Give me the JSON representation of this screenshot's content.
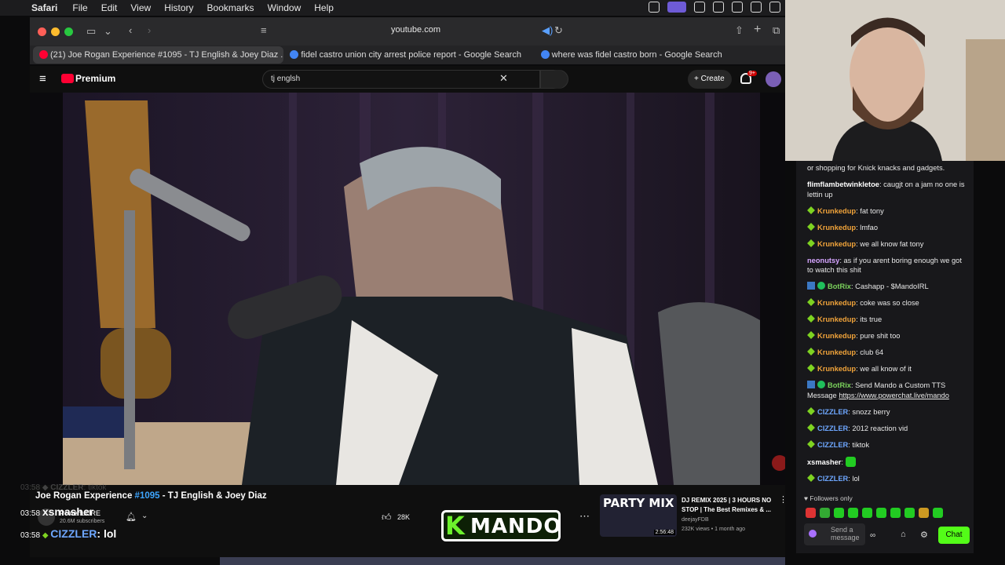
{
  "menubar": {
    "app": "Safari",
    "items": [
      "File",
      "Edit",
      "View",
      "History",
      "Bookmarks",
      "Window",
      "Help"
    ]
  },
  "browser": {
    "url": "youtube.com",
    "tabs": [
      {
        "title": "(21) Joe Rogan Experience #1095 - TJ English & Joey Diaz ..."
      },
      {
        "title": "fidel castro union city arrest police report - Google Search"
      },
      {
        "title": "where was fidel castro born - Google Search"
      }
    ]
  },
  "youtube": {
    "logo": "Premium",
    "search_value": "tj englsh",
    "create_label": "Create",
    "notif_count": "9+",
    "video": {
      "title_prefix": "Joe Rogan Experience ",
      "title_link": "#1095",
      "title_suffix": " - TJ English & Joey Diaz",
      "channel": "PowerfulJRE",
      "subscribers": "20.6M subscribers",
      "likes": "28K"
    },
    "recommended": {
      "thumb_text": "PARTY MIX",
      "title": "DJ REMIX 2025 | 3 HOURS NO STOP | The Best Remixes & ...",
      "channel": "deejayFDB",
      "meta": "232K views • 1 month ago",
      "duration": "2:56:48"
    }
  },
  "overlay": {
    "mando": "MANDO",
    "lines": [
      {
        "time": "03:58",
        "user": "CIZZLER",
        "text": "tiktok"
      },
      {
        "time": "03:58",
        "user": "xsmasher",
        "text": ""
      },
      {
        "time": "03:58",
        "user": "CIZZLER",
        "text": "lol"
      }
    ]
  },
  "chat": {
    "messages": [
      {
        "user": "",
        "text": "or shopping for Knick knacks and gadgets.",
        "color": "#e8e8e8"
      },
      {
        "user": "flimflambetwinkletoe",
        "text": "caugjt on a jam no one is lettin up",
        "color": "#ffffff"
      },
      {
        "user": "Krunkedup",
        "text": "fat tony",
        "color": "#f0a33a"
      },
      {
        "user": "Krunkedup",
        "text": "lmfao",
        "color": "#f0a33a"
      },
      {
        "user": "Krunkedup",
        "text": "we all know fat tony",
        "color": "#f0a33a"
      },
      {
        "user": "neonutsy",
        "text": "as if you arent boring enough we got to watch this shit",
        "color": "#d5a5ff"
      },
      {
        "user": "BotRix",
        "text": "Cashapp - $MandoIRL",
        "color": "#7bd35c"
      },
      {
        "user": "Krunkedup",
        "text": "coke was so close",
        "color": "#f0a33a"
      },
      {
        "user": "Krunkedup",
        "text": "its true",
        "color": "#f0a33a"
      },
      {
        "user": "Krunkedup",
        "text": "pure shit too",
        "color": "#f0a33a"
      },
      {
        "user": "Krunkedup",
        "text": "club 64",
        "color": "#f0a33a"
      },
      {
        "user": "Krunkedup",
        "text": "we all know of it",
        "color": "#f0a33a"
      },
      {
        "user": "BotRix",
        "text": "Send Mando a Custom TTS Message",
        "link": "https://www.powerchat.live/mando",
        "color": "#7bd35c"
      },
      {
        "user": "CIZZLER",
        "text": "snozz berry",
        "color": "#6ea7ff"
      },
      {
        "user": "CIZZLER",
        "text": "2012 reaction vid",
        "color": "#6ea7ff"
      },
      {
        "user": "CIZZLER",
        "text": "tiktok",
        "color": "#6ea7ff"
      },
      {
        "user": "xsmasher",
        "text": "",
        "color": "#ffffff"
      },
      {
        "user": "CIZZLER",
        "text": "lol",
        "color": "#6ea7ff"
      }
    ],
    "followers_only": "Followers only",
    "input_placeholder": "Send a message",
    "chat_button": "Chat"
  }
}
